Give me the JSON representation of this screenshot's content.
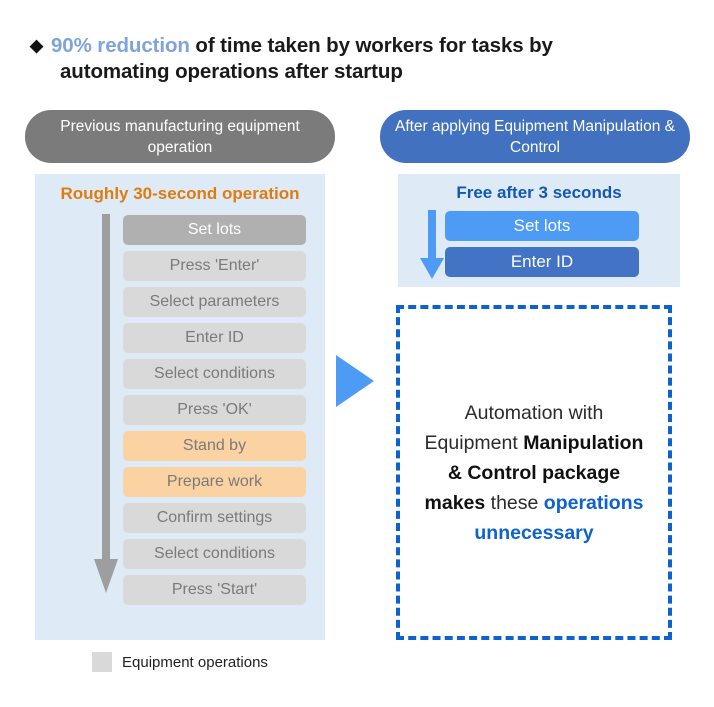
{
  "heading": {
    "bullet": "◆",
    "accent_text": "90% reduction",
    "rest_line1": " of time taken by workers for tasks by",
    "line2": "automating operations after startup"
  },
  "columns": {
    "left_header": "Previous manufacturing equipment operation",
    "right_header": "After applying Equipment Manipulation & Control"
  },
  "left_panel": {
    "title": "Roughly 30-second operation",
    "arrow_icon": "down-arrow-icon",
    "steps": [
      {
        "label": "Set lots",
        "style": "first"
      },
      {
        "label": "Press 'Enter'",
        "style": "normal"
      },
      {
        "label": "Select parameters",
        "style": "normal"
      },
      {
        "label": "Enter ID",
        "style": "normal"
      },
      {
        "label": "Select conditions",
        "style": "normal"
      },
      {
        "label": "Press 'OK'",
        "style": "normal"
      },
      {
        "label": "Stand by",
        "style": "highlight"
      },
      {
        "label": "Prepare work",
        "style": "highlight"
      },
      {
        "label": "Confirm settings",
        "style": "normal"
      },
      {
        "label": "Select conditions",
        "style": "normal"
      },
      {
        "label": "Press 'Start'",
        "style": "normal"
      }
    ]
  },
  "transition": {
    "arrow_icon": "right-triangle-arrow-icon"
  },
  "right_panel": {
    "title": "Free after 3 seconds",
    "arrow_icon": "down-arrow-icon",
    "steps": [
      {
        "label": "Set lots",
        "style": "light"
      },
      {
        "label": "Enter ID",
        "style": "dark"
      }
    ]
  },
  "callout": {
    "part1": "Automation with Equipment ",
    "part2_bold": "Manipulation & Control package makes",
    "part3": " these ",
    "part4_blue": "operations unnecessary"
  },
  "legend": {
    "swatch_name": "equipment-operations-swatch",
    "label": "Equipment operations"
  },
  "colors": {
    "accent_blue_heading": "#7FA3DB",
    "header_gray": "#7b7b7b",
    "header_blue": "#4272bf",
    "panel_light_blue": "#deebf7",
    "orange_title": "#e07b0f",
    "orange_step": "#fbd2a1",
    "gray_step": "#d9d9d9",
    "gray_step_first": "#b0b0b0",
    "blue_step_light": "#4d9bf5",
    "blue_step_dark": "#4273c5",
    "callout_border_blue": "#0d62cf",
    "dark_blue_text": "#1358b4"
  }
}
